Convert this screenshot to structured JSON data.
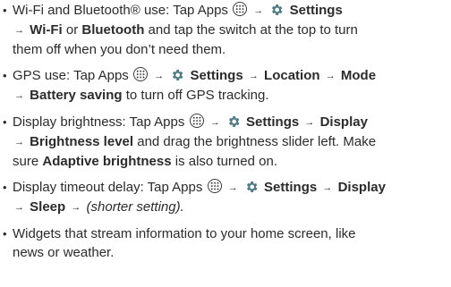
{
  "items": [
    {
      "l1_a": "Wi-Fi and Bluetooth® use: Tap Apps",
      "settings": "Settings",
      "wifi": "Wi-Fi",
      "or": "or",
      "bluetooth": "Bluetooth",
      "l2_tail": "and tap the switch at the top to turn",
      "l3": "them off when you don’t need them."
    },
    {
      "l1_a": "GPS use: Tap Apps",
      "settings": "Settings",
      "location": "Location",
      "mode": "Mode",
      "battery_saving": "Battery saving",
      "l2_tail": "to turn off GPS tracking."
    },
    {
      "l1_a": "Display brightness: Tap Apps",
      "settings": "Settings",
      "display": "Display",
      "brightness_level": "Brightness level",
      "l2_tail": "and drag the brightness slider left. Make",
      "l3_a": "sure",
      "adaptive_brightness": "Adaptive brightness",
      "l3_b": "is also turned on."
    },
    {
      "l1_a": "Display timeout delay: Tap Apps",
      "settings": "Settings",
      "display": "Display",
      "sleep": "Sleep",
      "shorter": "(shorter setting)."
    },
    {
      "l1": "Widgets that stream information to your home screen, like",
      "l2": "news or weather."
    }
  ],
  "icons": {
    "apps": "apps-grid-icon",
    "settings": "gear-icon"
  },
  "colors": {
    "text": "#2b2b2b",
    "gear": "#4f7a86"
  }
}
